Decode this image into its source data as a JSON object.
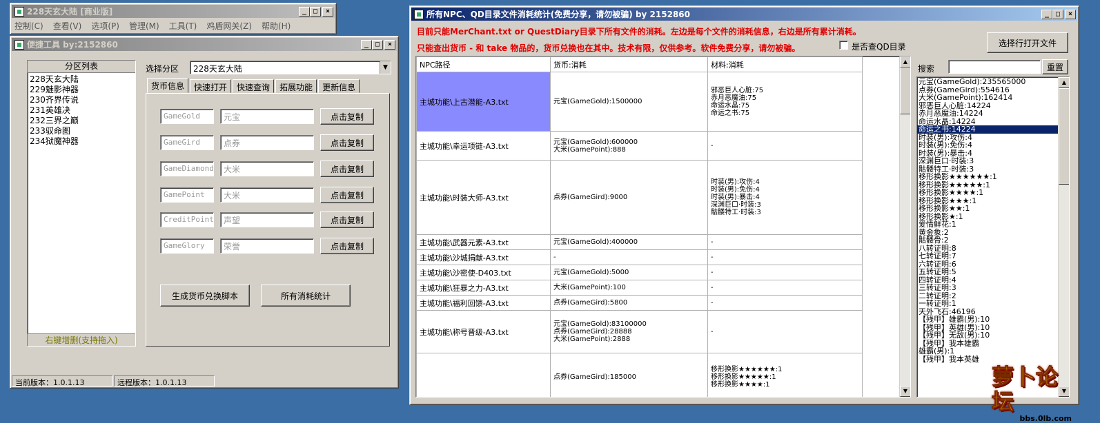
{
  "colors": {
    "desktop": "#3a6ea5",
    "title_active": "#0a246a",
    "warning_red": "#e00000",
    "selection": "#8a8aff"
  },
  "bg_window": {
    "title": "228天玄大陆 [商业版]",
    "menu": [
      "控制(C)",
      "查看(V)",
      "选项(P)",
      "管理(M)",
      "工具(T)",
      "鸡盾网关(Z)",
      "帮助(H)"
    ]
  },
  "quick_tool": {
    "title": "便捷工具   by:2152860",
    "zone_list_header": "分区列表",
    "zones": [
      "228天玄大陆",
      "229魅影神器",
      "230齐界传说",
      "231英雄决",
      "232三界之巅",
      "233驭命图",
      "234狱魔神器"
    ],
    "zone_list_footer": "右键增删(支持拖入)",
    "select_zone_label": "选择分区",
    "select_zone_value": "228天玄大陆",
    "tabs": [
      "货币信息",
      "快速打开",
      "快速查询",
      "拓展功能",
      "更新信息"
    ],
    "currencies": [
      {
        "code": "GameGold",
        "name": "元宝",
        "button": "点击复制"
      },
      {
        "code": "GameGird",
        "name": "点券",
        "button": "点击复制"
      },
      {
        "code": "GameDiamond",
        "name": "大米",
        "button": "点击复制"
      },
      {
        "code": "GamePoint",
        "name": "大米",
        "button": "点击复制"
      },
      {
        "code": "CreditPoint",
        "name": "声望",
        "button": "点击复制"
      },
      {
        "code": "GameGlory",
        "name": "荣誉",
        "button": "点击复制"
      }
    ],
    "gen_script_button": "生成货币兑换脚本",
    "all_stats_button": "所有消耗统计",
    "status_current": "当前版本：1.0.1.13",
    "status_remote": "远程版本：1.0.1.13"
  },
  "stats_window": {
    "title": "所有NPC、QD目录文件消耗统计(免费分享，请勿被骗)      by 2152860",
    "notice_1": "目前只能MerChant.txt or QuestDiary目录下所有文件的消耗。左边是每个文件的消耗信息，右边是所有累计消耗。",
    "notice_2": "只能查出货币 - 和 take 物品的，货币兑换也在其中。技术有限，仅供参考。软件免费分享，请勿被骗。",
    "checkbox_label": "是否查QD目录",
    "open_button": "选择行打开文件",
    "search_label": "搜索",
    "reset_button": "重置",
    "columns": [
      "NPC路径",
      "货币:消耗",
      "材料:消耗"
    ],
    "rows": [
      {
        "path": "主城功能\\上古潜能-A3.txt",
        "currency": [
          "元宝(GameGold):1500000"
        ],
        "material": [
          "邪恶巨人心脏:75",
          "赤月恶魔油:75",
          "命运水晶:75",
          "命运之书:75"
        ]
      },
      {
        "path": "主城功能\\幸运项链-A3.txt",
        "currency": [
          "元宝(GameGold):600000",
          "大米(GamePoint):888"
        ],
        "material": [
          "-"
        ]
      },
      {
        "path": "主城功能\\时装大师-A3.txt",
        "currency": [
          "点券(GameGird):9000"
        ],
        "material": [
          "时装(男):攻伤:4",
          "时装(男):免伤:4",
          "时装(男):暴击:4",
          "深渊巨口·时装:3",
          "骷髅特工·时装:3"
        ]
      },
      {
        "path": "主城功能\\武器元素-A3.txt",
        "currency": [
          "元宝(GameGold):400000"
        ],
        "material": [
          "-"
        ]
      },
      {
        "path": "主城功能\\沙城捐献-A3.txt",
        "currency": [
          "-"
        ],
        "material": [
          "-"
        ]
      },
      {
        "path": "主城功能\\沙密使-D403.txt",
        "currency": [
          "元宝(GameGold):5000"
        ],
        "material": [
          "-"
        ]
      },
      {
        "path": "主城功能\\狂暴之力-A3.txt",
        "currency": [
          "大米(GamePoint):100"
        ],
        "material": [
          "-"
        ]
      },
      {
        "path": "主城功能\\福利回馈-A3.txt",
        "currency": [
          "点券(GameGird):5800"
        ],
        "material": [
          "-"
        ]
      },
      {
        "path": "主城功能\\称号晋级-A3.txt",
        "currency": [
          "元宝(GameGold):83100000",
          "点券(GameGird):28888",
          "大米(GamePoint):2888"
        ],
        "material": [
          "-"
        ]
      },
      {
        "path": "",
        "currency": [
          "点券(GameGird):185000"
        ],
        "material": [
          "移形换影★★★★★★:1",
          "移形换影★★★★★:1",
          "移形换影★★★★:1"
        ]
      }
    ],
    "totals": [
      "元宝(GameGold):235565000",
      "点券(GameGird):554616",
      "大米(GamePoint):162414",
      "邪恶巨人心脏:14224",
      "赤月恶魔油:14224",
      "命运水晶:14224",
      "命运之书:14224",
      "时装(男):攻伤:4",
      "时装(男):免伤:4",
      "时装(男):暴击:4",
      "深渊巨口·时装:3",
      "骷髅特工·时装:3",
      "移形换影★★★★★★:1",
      "移形换影★★★★★:1",
      "移形换影★★★★:1",
      "移形换影★★★:1",
      "移形换影★★:1",
      "移形换影★:1",
      "爱情鲜花:1",
      "黄金象:2",
      "骷髅骨:2",
      "八转证明:8",
      "七转证明:7",
      "六转证明:6",
      "五转证明:5",
      "四转证明:4",
      "三转证明:3",
      "二转证明:2",
      "一转证明:1",
      "天外飞石:46196",
      "【残甲】雄霸(男):10",
      "【残甲】英雄(男):10",
      "【残甲】无敌(男):10",
      "【残甲】我本雄霸",
      "雄霸(男):1",
      "【残甲】我本英雄"
    ],
    "selected_total_index": 6
  },
  "watermark": {
    "logo": "萝卜论坛",
    "site": "bbs.0lb.com"
  }
}
